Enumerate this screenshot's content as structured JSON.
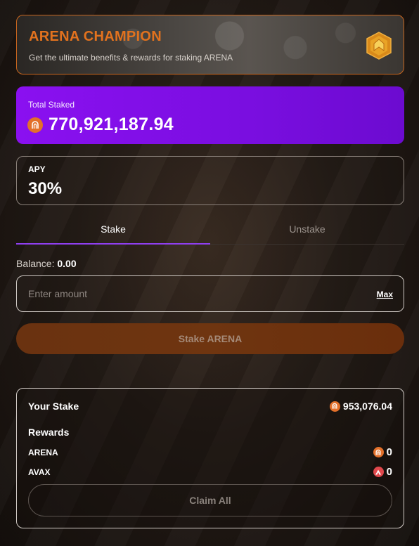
{
  "banner": {
    "title": "ARENA CHAMPION",
    "subtitle": "Get the ultimate benefits & rewards for staking ARENA",
    "badge_icon": "chevron-up-badge-icon"
  },
  "total_staked": {
    "label": "Total Staked",
    "value": "770,921,187.94",
    "icon": "arena-token-icon"
  },
  "apy": {
    "label": "APY",
    "value": "30%"
  },
  "tabs": [
    {
      "label": "Stake",
      "active": true
    },
    {
      "label": "Unstake",
      "active": false
    }
  ],
  "balance": {
    "label": "Balance:",
    "value": "0.00"
  },
  "amount_input": {
    "placeholder": "Enter amount",
    "value": "",
    "max_label": "Max"
  },
  "stake_button": {
    "label": "Stake ARENA"
  },
  "your_stake": {
    "label": "Your Stake",
    "value": "953,076.04",
    "rewards_label": "Rewards",
    "rewards": [
      {
        "token": "ARENA",
        "value": "0",
        "icon": "arena-token-icon"
      },
      {
        "token": "AVAX",
        "value": "0",
        "icon": "avax-token-icon"
      }
    ],
    "claim_label": "Claim All"
  },
  "colors": {
    "accent_orange": "#e2721e",
    "accent_purple": "#8a10f0",
    "tab_underline": "#8f3ff0",
    "avax_red": "#e0484c"
  }
}
